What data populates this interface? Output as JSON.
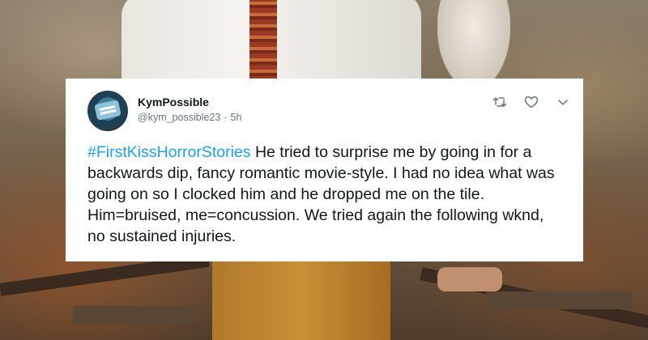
{
  "tweet": {
    "display_name": "KymPossible",
    "handle": "@kym_possible23",
    "separator": "·",
    "time": "5h",
    "hashtag": "#FirstKissHorrorStories",
    "text": " He tried to surprise me by going in for a backwards dip, fancy romantic movie-style. I had no idea what was going on so I clocked him and he dropped me on the tile. Him=bruised, me=concussion. We tried again the following wknd, no sustained injuries.",
    "actions": [
      {
        "name": "retweet-icon"
      },
      {
        "name": "like-icon"
      },
      {
        "name": "chevron-down-icon"
      }
    ]
  },
  "colors": {
    "hashtag": "#1da1f2",
    "text": "#14171a",
    "meta": "#657786",
    "icon": "#657786"
  }
}
